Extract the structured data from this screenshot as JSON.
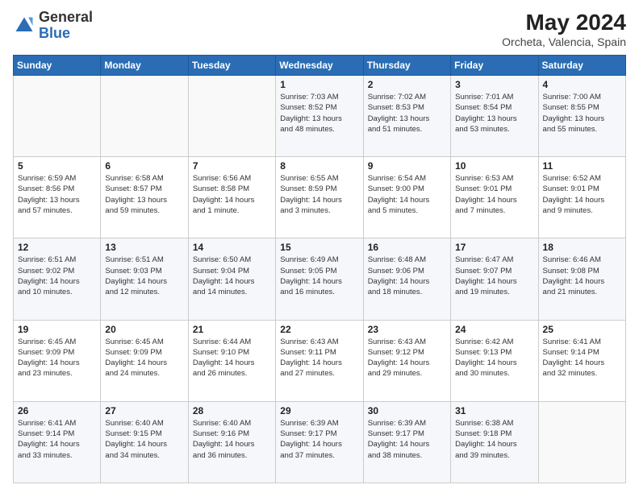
{
  "header": {
    "logo_general": "General",
    "logo_blue": "Blue",
    "month_year": "May 2024",
    "location": "Orcheta, Valencia, Spain"
  },
  "days_of_week": [
    "Sunday",
    "Monday",
    "Tuesday",
    "Wednesday",
    "Thursday",
    "Friday",
    "Saturday"
  ],
  "weeks": [
    [
      {
        "day": "",
        "info": ""
      },
      {
        "day": "",
        "info": ""
      },
      {
        "day": "",
        "info": ""
      },
      {
        "day": "1",
        "info": "Sunrise: 7:03 AM\nSunset: 8:52 PM\nDaylight: 13 hours\nand 48 minutes."
      },
      {
        "day": "2",
        "info": "Sunrise: 7:02 AM\nSunset: 8:53 PM\nDaylight: 13 hours\nand 51 minutes."
      },
      {
        "day": "3",
        "info": "Sunrise: 7:01 AM\nSunset: 8:54 PM\nDaylight: 13 hours\nand 53 minutes."
      },
      {
        "day": "4",
        "info": "Sunrise: 7:00 AM\nSunset: 8:55 PM\nDaylight: 13 hours\nand 55 minutes."
      }
    ],
    [
      {
        "day": "5",
        "info": "Sunrise: 6:59 AM\nSunset: 8:56 PM\nDaylight: 13 hours\nand 57 minutes."
      },
      {
        "day": "6",
        "info": "Sunrise: 6:58 AM\nSunset: 8:57 PM\nDaylight: 13 hours\nand 59 minutes."
      },
      {
        "day": "7",
        "info": "Sunrise: 6:56 AM\nSunset: 8:58 PM\nDaylight: 14 hours\nand 1 minute."
      },
      {
        "day": "8",
        "info": "Sunrise: 6:55 AM\nSunset: 8:59 PM\nDaylight: 14 hours\nand 3 minutes."
      },
      {
        "day": "9",
        "info": "Sunrise: 6:54 AM\nSunset: 9:00 PM\nDaylight: 14 hours\nand 5 minutes."
      },
      {
        "day": "10",
        "info": "Sunrise: 6:53 AM\nSunset: 9:01 PM\nDaylight: 14 hours\nand 7 minutes."
      },
      {
        "day": "11",
        "info": "Sunrise: 6:52 AM\nSunset: 9:01 PM\nDaylight: 14 hours\nand 9 minutes."
      }
    ],
    [
      {
        "day": "12",
        "info": "Sunrise: 6:51 AM\nSunset: 9:02 PM\nDaylight: 14 hours\nand 10 minutes."
      },
      {
        "day": "13",
        "info": "Sunrise: 6:51 AM\nSunset: 9:03 PM\nDaylight: 14 hours\nand 12 minutes."
      },
      {
        "day": "14",
        "info": "Sunrise: 6:50 AM\nSunset: 9:04 PM\nDaylight: 14 hours\nand 14 minutes."
      },
      {
        "day": "15",
        "info": "Sunrise: 6:49 AM\nSunset: 9:05 PM\nDaylight: 14 hours\nand 16 minutes."
      },
      {
        "day": "16",
        "info": "Sunrise: 6:48 AM\nSunset: 9:06 PM\nDaylight: 14 hours\nand 18 minutes."
      },
      {
        "day": "17",
        "info": "Sunrise: 6:47 AM\nSunset: 9:07 PM\nDaylight: 14 hours\nand 19 minutes."
      },
      {
        "day": "18",
        "info": "Sunrise: 6:46 AM\nSunset: 9:08 PM\nDaylight: 14 hours\nand 21 minutes."
      }
    ],
    [
      {
        "day": "19",
        "info": "Sunrise: 6:45 AM\nSunset: 9:09 PM\nDaylight: 14 hours\nand 23 minutes."
      },
      {
        "day": "20",
        "info": "Sunrise: 6:45 AM\nSunset: 9:09 PM\nDaylight: 14 hours\nand 24 minutes."
      },
      {
        "day": "21",
        "info": "Sunrise: 6:44 AM\nSunset: 9:10 PM\nDaylight: 14 hours\nand 26 minutes."
      },
      {
        "day": "22",
        "info": "Sunrise: 6:43 AM\nSunset: 9:11 PM\nDaylight: 14 hours\nand 27 minutes."
      },
      {
        "day": "23",
        "info": "Sunrise: 6:43 AM\nSunset: 9:12 PM\nDaylight: 14 hours\nand 29 minutes."
      },
      {
        "day": "24",
        "info": "Sunrise: 6:42 AM\nSunset: 9:13 PM\nDaylight: 14 hours\nand 30 minutes."
      },
      {
        "day": "25",
        "info": "Sunrise: 6:41 AM\nSunset: 9:14 PM\nDaylight: 14 hours\nand 32 minutes."
      }
    ],
    [
      {
        "day": "26",
        "info": "Sunrise: 6:41 AM\nSunset: 9:14 PM\nDaylight: 14 hours\nand 33 minutes."
      },
      {
        "day": "27",
        "info": "Sunrise: 6:40 AM\nSunset: 9:15 PM\nDaylight: 14 hours\nand 34 minutes."
      },
      {
        "day": "28",
        "info": "Sunrise: 6:40 AM\nSunset: 9:16 PM\nDaylight: 14 hours\nand 36 minutes."
      },
      {
        "day": "29",
        "info": "Sunrise: 6:39 AM\nSunset: 9:17 PM\nDaylight: 14 hours\nand 37 minutes."
      },
      {
        "day": "30",
        "info": "Sunrise: 6:39 AM\nSunset: 9:17 PM\nDaylight: 14 hours\nand 38 minutes."
      },
      {
        "day": "31",
        "info": "Sunrise: 6:38 AM\nSunset: 9:18 PM\nDaylight: 14 hours\nand 39 minutes."
      },
      {
        "day": "",
        "info": ""
      }
    ]
  ]
}
